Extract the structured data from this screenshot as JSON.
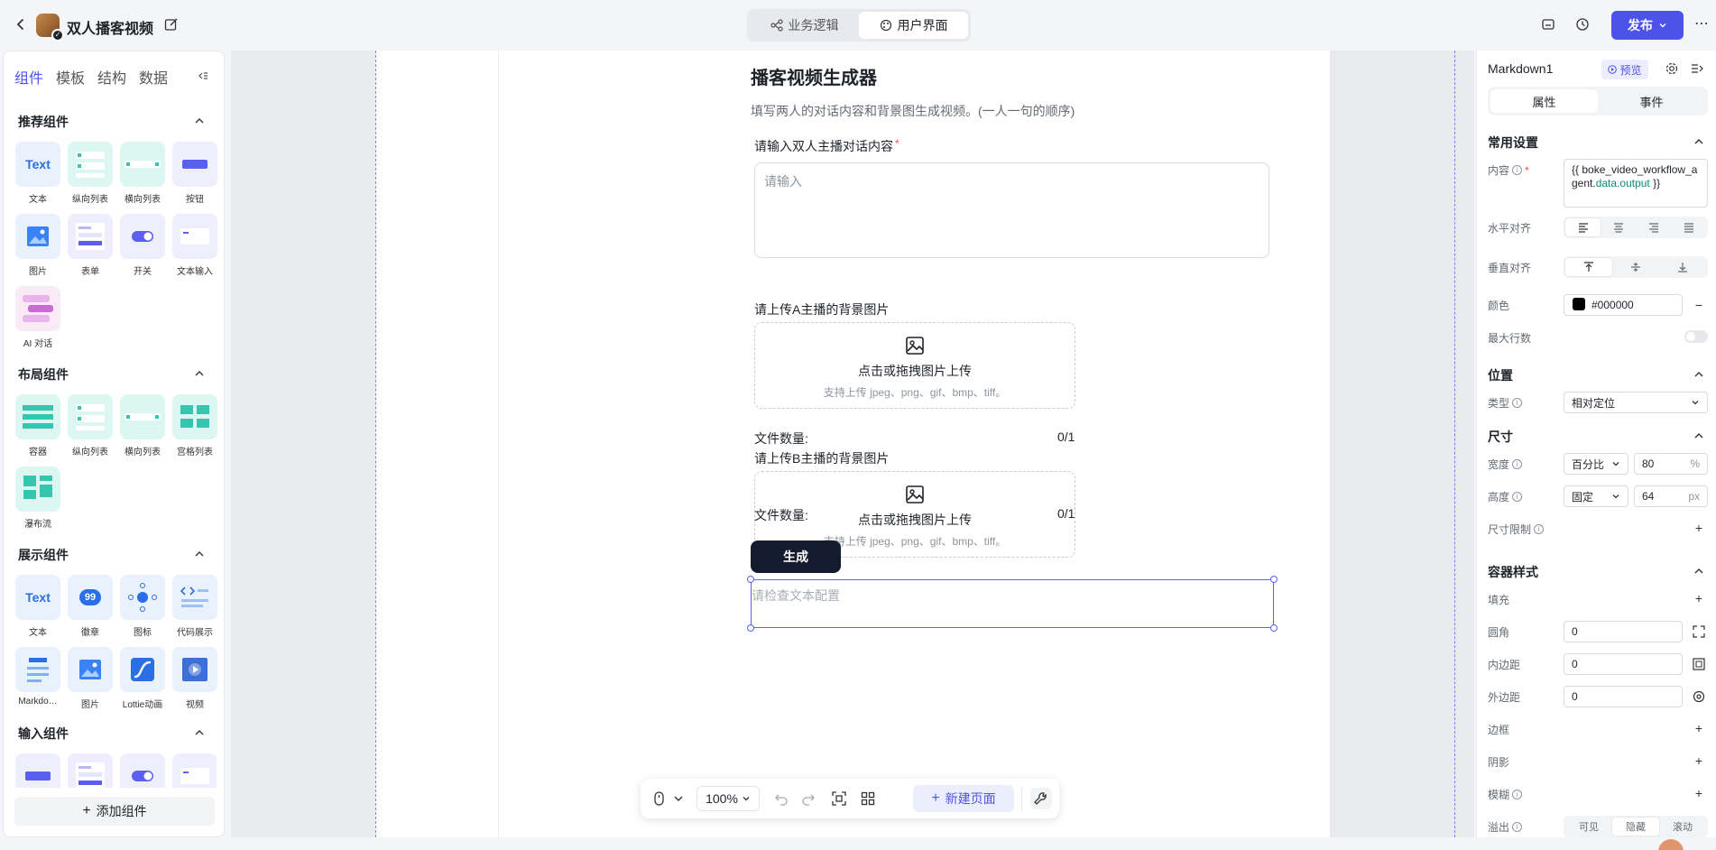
{
  "app": {
    "title": "双人播客视频",
    "mode_tabs": [
      "业务逻辑",
      "用户界面"
    ],
    "active_mode": "用户界面",
    "publish_label": "发布"
  },
  "left_panel": {
    "tabs": [
      "组件",
      "模板",
      "结构",
      "数据"
    ],
    "active_tab": "组件",
    "sections": {
      "recommended": {
        "title": "推荐组件",
        "items": [
          "文本",
          "纵向列表",
          "横向列表",
          "按钮",
          "图片",
          "表单",
          "开关",
          "文本输入",
          "AI 对话"
        ]
      },
      "layout": {
        "title": "布局组件",
        "items": [
          "容器",
          "纵向列表",
          "横向列表",
          "宫格列表",
          "瀑布流"
        ]
      },
      "display": {
        "title": "展示组件",
        "items": [
          "文本",
          "徽章",
          "图标",
          "代码展示",
          "Markdo…",
          "图片",
          "Lottie动画",
          "视频"
        ]
      },
      "input": {
        "title": "输入组件"
      }
    },
    "tile_text": "Text",
    "badge_num": "99",
    "add_component_label": "添加组件"
  },
  "canvas": {
    "form_title": "播客视频生成器",
    "form_desc": "填写两人的对话内容和背景图生成视频。(一人一句的顺序)",
    "dialog_label": "请输入双人主播对话内容",
    "required_mark": "*",
    "dialog_placeholder": "请输入",
    "upload_a_label": "请上传A主播的背景图片",
    "upload_b_label": "请上传B主播的背景图片",
    "upload_title": "点击或拖拽图片上传",
    "upload_hint": "支持上传 jpeg、png、gif、bmp、tiff。",
    "file_count_label": "文件数量:",
    "file_count_value": "0/1",
    "generate_label": "生成",
    "markdown_placeholder": "请检查文本配置"
  },
  "toolbar": {
    "zoom": "100%",
    "new_page_label": "新建页面"
  },
  "right_panel": {
    "component_name": "Markdown1",
    "preview_label": "预览",
    "tabs": [
      "属性",
      "事件"
    ],
    "active_tab": "属性",
    "common": {
      "title": "常用设置",
      "content_label": "内容",
      "content_prefix": "{{ boke_video_workflow_agent.",
      "content_highlight": "data.output",
      "content_suffix": " }}",
      "halign_label": "水平对齐",
      "valign_label": "垂直对齐",
      "color_label": "颜色",
      "color_value": "#000000",
      "maxlines_label": "最大行数"
    },
    "position": {
      "title": "位置",
      "type_label": "类型",
      "type_value": "相对定位"
    },
    "size": {
      "title": "尺寸",
      "width_label": "宽度",
      "width_mode": "百分比",
      "width_value": "80",
      "width_unit": "%",
      "height_label": "高度",
      "height_mode": "固定",
      "height_value": "64",
      "height_unit": "px",
      "limit_label": "尺寸限制"
    },
    "style": {
      "title": "容器样式",
      "fill_label": "填充",
      "radius_label": "圆角",
      "radius_value": "0",
      "padding_label": "内边距",
      "padding_value": "0",
      "margin_label": "外边距",
      "margin_value": "0",
      "border_label": "边框",
      "shadow_label": "阴影",
      "blur_label": "模糊",
      "overflow_label": "溢出",
      "overflow_options": [
        "可见",
        "隐藏",
        "滚动"
      ]
    }
  },
  "colors": {
    "accent": "#4d53e8",
    "dark_button": "#151b2e",
    "selection": "#5b5ff0"
  }
}
